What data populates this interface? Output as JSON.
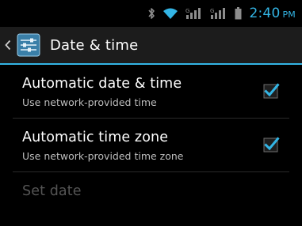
{
  "status_bar": {
    "time": "2:40",
    "ampm": "PM",
    "icons": [
      "bluetooth-icon",
      "wifi-icon",
      "signal-icon-1",
      "signal-icon-2",
      "battery-icon"
    ],
    "accent": "#33b5e5"
  },
  "action_bar": {
    "title": "Date & time",
    "icon": "settings-sliders-icon",
    "background": "#1c1c1c",
    "divider_color": "#33b5e5"
  },
  "preferences": [
    {
      "title": "Automatic date & time",
      "summary": "Use network-provided time",
      "checked": true,
      "enabled": true
    },
    {
      "title": "Automatic time zone",
      "summary": "Use network-provided time zone",
      "checked": true,
      "enabled": true
    },
    {
      "title": "Set date",
      "summary": "",
      "enabled": false
    }
  ]
}
